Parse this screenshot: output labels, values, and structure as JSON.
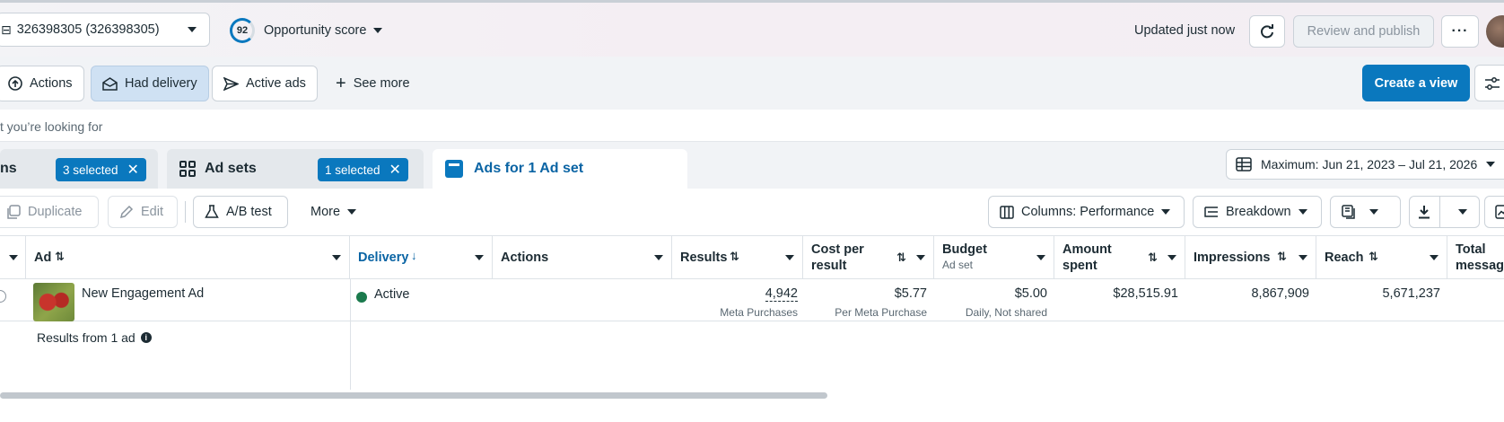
{
  "header": {
    "account": "326398305 (326398305)",
    "opportunity_score": "92",
    "opportunity_label": "Opportunity score",
    "updated": "Updated just now",
    "review_publish": "Review and publish",
    "more": "···"
  },
  "filters": {
    "chips": [
      "Actions",
      "Had delivery",
      "Active ads",
      "See more"
    ],
    "create_view": "Create a view"
  },
  "search": {
    "placeholder_visible": "t you’re looking for"
  },
  "tabs": {
    "left_label": "ns",
    "left_badge": "3 selected",
    "mid_label": "Ad sets",
    "mid_badge": "1 selected",
    "current_label": "Ads for 1 Ad set",
    "date_range": "Maximum: Jun 21, 2023 – Jul 21, 2026"
  },
  "toolbar": {
    "duplicate": "Duplicate",
    "edit": "Edit",
    "ab_test": "A/B test",
    "more": "More",
    "columns": "Columns: Performance",
    "breakdown": "Breakdown"
  },
  "table": {
    "headers": {
      "ad": "Ad",
      "delivery": "Delivery",
      "actions": "Actions",
      "results": "Results",
      "cost_per_result_1": "Cost per",
      "cost_per_result_2": "result",
      "budget": "Budget",
      "budget_sub": "Ad set",
      "amount_spent_1": "Amount",
      "amount_spent_2": "spent",
      "impressions": "Impressions",
      "reach": "Reach",
      "total_msg_1": "Total",
      "total_msg_2": "messagi"
    },
    "row": {
      "ad_name": "New Engagement Ad",
      "delivery": "Active",
      "results": "4,942",
      "results_sub": "Meta Purchases",
      "cost": "$5.77",
      "cost_sub": "Per Meta Purchase",
      "budget": "$5.00",
      "budget_sub": "Daily, Not shared",
      "amount_spent": "$28,515.91",
      "impressions": "8,867,909",
      "reach": "5,671,237"
    },
    "summary": "Results from 1 ad"
  },
  "colors": {
    "accent": "#0a78be",
    "active_status": "#1b7a4d"
  }
}
